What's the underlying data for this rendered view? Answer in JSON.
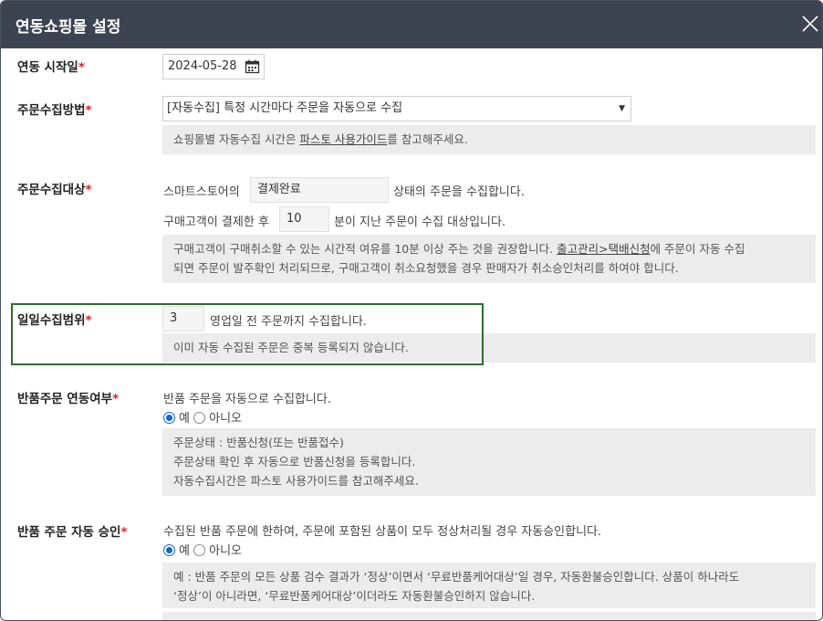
{
  "modal": {
    "title": "연동쇼핑몰 설정",
    "close_icon": "close-icon"
  },
  "start_date": {
    "label": "연동 시작일",
    "required_mark": "*",
    "value": "2024-05-28",
    "icon": "calendar-icon"
  },
  "collect_method": {
    "label": "주문수집방법",
    "required_mark": "*",
    "selected": "[자동수집] 특정 시간마다 주문을 자동으로 수집",
    "info_prefix": "쇼핑몰별 자동수집 시간은 ",
    "info_link": "파스토 사용가이드",
    "info_suffix": "를 참고해주세요."
  },
  "collect_target": {
    "label": "주문수집대상",
    "required_mark": "*",
    "line1_prefix": "스마트스토어의",
    "status_value": "결제완료",
    "line1_suffix": "상태의 주문을 수집합니다.",
    "line2_prefix": "구매고객이 결제한 후",
    "minutes_value": "10",
    "line2_suffix": "분이 지난 주문이 수집 대상입니다.",
    "info_part1": "구매고객이 구매취소할 수 있는 시간적 여유를 10분 이상 주는 것을 권장합니다. ",
    "info_link": "출고관리>택배신청",
    "info_part2": "에 주문이 자동 수집",
    "info_line2": "되면 주문이 발주확인 처리되므로, 구매고객이 취소요청했을 경우 판매자가 취소승인처리를 하여야 합니다."
  },
  "daily_range": {
    "label": "일일수집범위",
    "required_mark": "*",
    "days_value": "3",
    "suffix": "영업일 전 주문까지 수집합니다.",
    "info": "이미 자동 수집된 주문은 중복 등록되지 않습니다."
  },
  "return_link": {
    "label": "반품주문 연동여부",
    "required_mark": "*",
    "desc": "반품 주문을 자동으로 수집합니다.",
    "option_yes": "예",
    "option_no": "아니오",
    "info_line1": "주문상태 : 반품신청(또는 반품접수)",
    "info_line2": "주문상태 확인 후 자동으로 반품신청을 등록합니다.",
    "info_line3": "자동수집시간은 파스토 사용가이드를 참고해주세요."
  },
  "return_approve": {
    "label": "반품 주문 자동 승인",
    "required_mark": "*",
    "desc": "수집된 반품 주문에 한하여, 주문에 포함된 상품이 모두 정상처리될 경우 자동승인합니다.",
    "option_yes": "예",
    "option_no": "아니오",
    "info_line1": "예 : 반품 주문의 모든 상품 검수 결과가 ‘정상’이면서 ‘무료반품케어대상’일 경우, 자동환불승인합니다. 상품이 하나라도",
    "info_line2": "‘정상’이 아니라면, ‘무료반품케어대상’이더라도 자동환불승인하지 않습니다."
  }
}
